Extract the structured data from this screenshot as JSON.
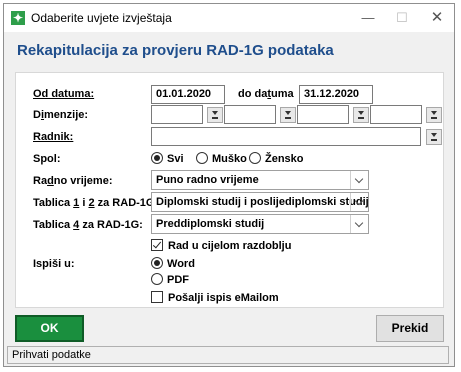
{
  "window": {
    "title": "Odaberite uvjete izvještaja",
    "minimize": "—",
    "maximize": "☐",
    "close": "✕",
    "app_icon": "✦"
  },
  "header": {
    "title": "Rekapitulacija za provjeru RAD-1G podataka"
  },
  "form": {
    "od_datuma_label": "Od datuma:",
    "od_datuma_value": "01.01.2020",
    "do_datuma_label_a": "do da",
    "do_datuma_label_u": "t",
    "do_datuma_label_b": "uma",
    "do_datuma_value": "31.12.2020",
    "dimenzije_label_a": "D",
    "dimenzije_label_u": "i",
    "dimenzije_label_b": "menzije:",
    "radnik_label": "Radnik:",
    "spol_label": "Spol:",
    "spol_options": [
      "Svi",
      "Muško",
      "Žensko"
    ],
    "radno_vrijeme_label_a": "Ra",
    "radno_vrijeme_label_u": "d",
    "radno_vrijeme_label_b": "no vrijeme:",
    "radno_vrijeme_value": "Puno radno vrijeme",
    "tablica12_label_a": "Tablica ",
    "tablica12_label_u1": "1",
    "tablica12_label_m": " i ",
    "tablica12_label_u2": "2",
    "tablica12_label_b": " za RAD-1G:",
    "tablica12_value": "Diplomski studij i poslijediplomski studij",
    "tablica4_label_a": "Tablica ",
    "tablica4_label_u": "4",
    "tablica4_label_b": " za RAD-1G:",
    "tablica4_value": "Preddiplomski studij",
    "rad_u_cijelom_label": "Rad u cijelom razdoblju",
    "ispisi_label": "Ispiši u:",
    "ispisi_word_u": "W",
    "ispisi_word_b": "ord",
    "ispisi_pdf": "PDF",
    "email_label_a": "Pošalji ispis ",
    "email_label_u": "e",
    "email_label_b": "Mailom"
  },
  "buttons": {
    "ok": "OK",
    "cancel": "Prekid"
  },
  "status": {
    "text": "Prihvati podatke"
  }
}
